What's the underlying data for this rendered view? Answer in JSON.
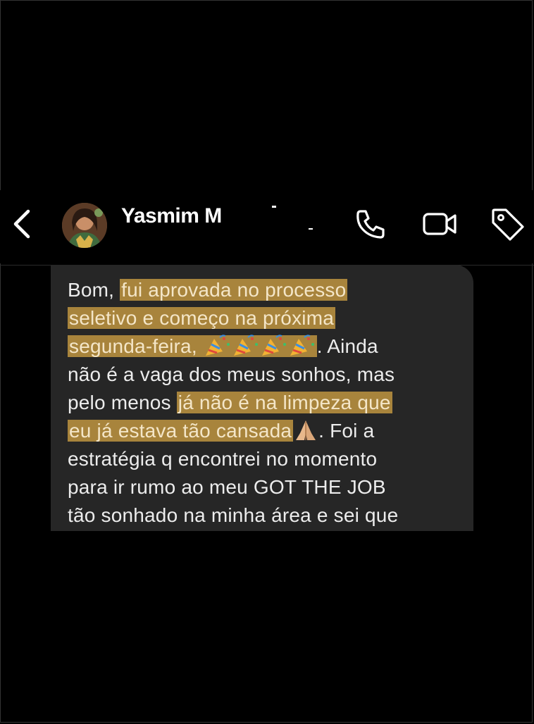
{
  "header": {
    "contact_name": "Yasmim M"
  },
  "icons": {
    "back": "back-chevron-icon",
    "phone": "phone-icon",
    "video": "video-camera-icon",
    "tag": "tag-icon"
  },
  "message": {
    "lines": [
      {
        "before": "Bom, ",
        "highlight": "fui aprovada no processo",
        "after": ""
      },
      {
        "before": "",
        "highlight": "seletivo e começo na próxima",
        "after": ""
      },
      {
        "before": "",
        "highlight": "segunda-feira, ",
        "after": ". Ainda"
      },
      {
        "before": "não é a vaga dos meus sonhos, mas",
        "highlight": "",
        "after": ""
      },
      {
        "before": "pelo menos ",
        "highlight": "já não é na limpeza que",
        "after": ""
      },
      {
        "before": "",
        "highlight": "eu já estava tão cansada",
        "after": ". Foi a"
      },
      {
        "before": "estratégia q encontrei no momento",
        "highlight": "",
        "after": ""
      },
      {
        "before": "para ir rumo ao meu GOT THE JOB",
        "highlight": "",
        "after": ""
      },
      {
        "before": "tão sonhado na minha área e sei que",
        "highlight": "",
        "after": ""
      }
    ],
    "emoji": {
      "party": "party-popper-icon",
      "pray": "folded-hands-icon"
    }
  }
}
